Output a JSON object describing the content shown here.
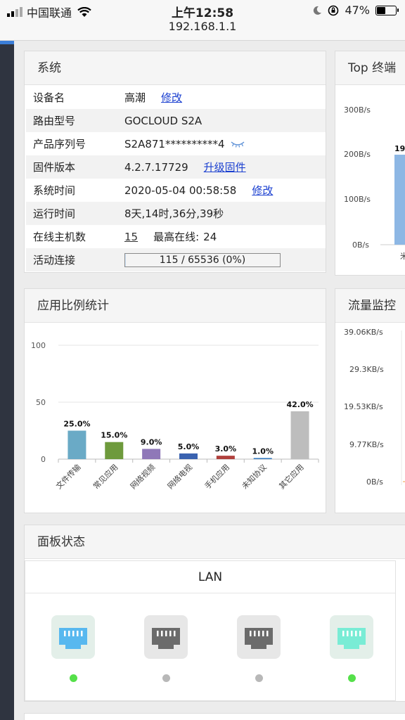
{
  "status_bar": {
    "carrier": "中国联通",
    "time": "上午12:58",
    "url": "192.168.1.1",
    "battery": "47%",
    "battery_level": 0.47
  },
  "system": {
    "title": "系统",
    "rows": {
      "device_name": {
        "label": "设备名",
        "value": "高潮",
        "link": "修改"
      },
      "model": {
        "label": "路由型号",
        "value": "GOCLOUD S2A"
      },
      "serial": {
        "label": "产品序列号",
        "value": "S2A871**********4"
      },
      "firmware": {
        "label": "固件版本",
        "value": "4.2.7.17729",
        "link": "升级固件"
      },
      "sys_time": {
        "label": "系统时间",
        "value": "2020-05-04 00:58:58",
        "link": "修改"
      },
      "uptime": {
        "label": "运行时间",
        "value": "8天,14时,36分,39秒"
      },
      "hosts": {
        "label": "在线主机数",
        "value": "15",
        "max_label": "最高在线:",
        "max_value": "24"
      },
      "connections": {
        "label": "活动连接",
        "value": "115 / 65536 (0%)",
        "used": 115,
        "total": 65536
      }
    }
  },
  "top_terminals": {
    "title": "Top 终端",
    "y_ticks": [
      "300B/s",
      "200B/s",
      "100B/s",
      "0B/s"
    ],
    "bar_label": "19",
    "x_label": "米"
  },
  "app_stats": {
    "title": "应用比例统计"
  },
  "chart_data": {
    "type": "bar",
    "categories": [
      "文件传输",
      "常见应用",
      "网络视频",
      "网络电视",
      "手机应用",
      "未知协议",
      "其它应用"
    ],
    "values": [
      25.0,
      15.0,
      9.0,
      5.0,
      3.0,
      1.0,
      42.0
    ],
    "labels": [
      "25.0%",
      "15.0%",
      "9.0%",
      "5.0%",
      "3.0%",
      "1.0%",
      "42.0%"
    ],
    "colors": [
      "#6aaac6",
      "#6e9a3c",
      "#8f78b8",
      "#3a62b0",
      "#b0403c",
      "#3a7ec0",
      "#bdbdbd"
    ],
    "y_ticks": [
      0,
      50,
      100
    ],
    "ylim": [
      0,
      100
    ],
    "grid": true
  },
  "traffic": {
    "title": "流量监控",
    "y_ticks": [
      "39.06KB/s",
      "29.3KB/s",
      "19.53KB/s",
      "9.77KB/s",
      "0B/s"
    ]
  },
  "panel_status": {
    "title": "面板状态",
    "lan_title": "LAN",
    "ports": [
      {
        "color": "#58b8ef",
        "status": "active"
      },
      {
        "color": "#6b6b6b",
        "status": "inactive"
      },
      {
        "color": "#6b6b6b",
        "status": "inactive"
      },
      {
        "color": "#79ecd5",
        "status": "active"
      }
    ],
    "status_colors": {
      "active": "#55e04a",
      "inactive": "#b8b8b8"
    }
  }
}
